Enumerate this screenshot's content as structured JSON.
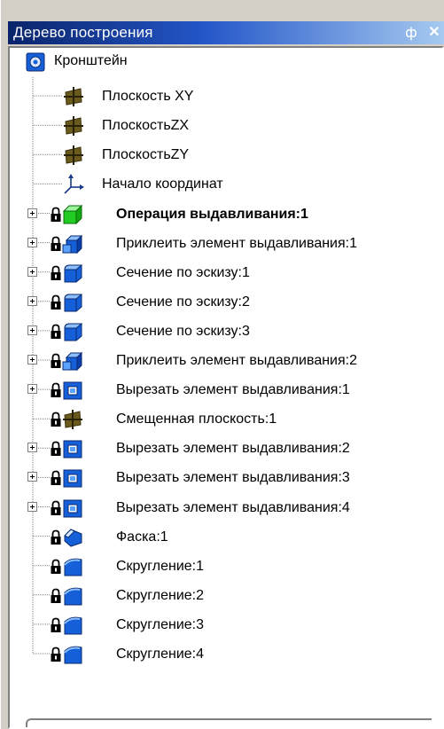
{
  "panel": {
    "title": "Дерево построения",
    "pin_label": "ф",
    "close_label": "✕"
  },
  "tree": {
    "root": {
      "label": "Кронштейн",
      "icon": "assembly-part-icon"
    },
    "items": [
      {
        "label": "Плоскость XY",
        "icon": "plane-icon",
        "expandable": false,
        "locked": false,
        "bold": false
      },
      {
        "label": "ПлоскостьZX",
        "icon": "plane-icon",
        "expandable": false,
        "locked": false,
        "bold": false
      },
      {
        "label": "ПлоскостьZY",
        "icon": "plane-icon",
        "expandable": false,
        "locked": false,
        "bold": false
      },
      {
        "label": "Начало координат",
        "icon": "origin-axes-icon",
        "expandable": false,
        "locked": false,
        "bold": false
      },
      {
        "label": "Операция выдавливания:1",
        "icon": "extrude-base-icon",
        "expandable": true,
        "locked": true,
        "bold": true
      },
      {
        "label": "Приклеить элемент выдавливания:1",
        "icon": "boss-extrude-icon",
        "expandable": true,
        "locked": true,
        "bold": false
      },
      {
        "label": "Сечение по эскизу:1",
        "icon": "sweep-icon",
        "expandable": true,
        "locked": true,
        "bold": false
      },
      {
        "label": "Сечение по эскизу:2",
        "icon": "sweep-icon",
        "expandable": true,
        "locked": true,
        "bold": false
      },
      {
        "label": "Сечение по эскизу:3",
        "icon": "sweep-icon",
        "expandable": true,
        "locked": true,
        "bold": false
      },
      {
        "label": "Приклеить элемент выдавливания:2",
        "icon": "boss-extrude-icon",
        "expandable": true,
        "locked": true,
        "bold": false
      },
      {
        "label": "Вырезать элемент выдавливания:1",
        "icon": "cut-extrude-icon",
        "expandable": true,
        "locked": true,
        "bold": false
      },
      {
        "label": "Смещенная плоскость:1",
        "icon": "plane-icon",
        "expandable": false,
        "locked": true,
        "bold": false
      },
      {
        "label": "Вырезать элемент выдавливания:2",
        "icon": "cut-extrude-icon",
        "expandable": true,
        "locked": true,
        "bold": false
      },
      {
        "label": "Вырезать элемент выдавливания:3",
        "icon": "cut-extrude-icon",
        "expandable": true,
        "locked": true,
        "bold": false
      },
      {
        "label": "Вырезать элемент выдавливания:4",
        "icon": "cut-extrude-icon",
        "expandable": true,
        "locked": true,
        "bold": false
      },
      {
        "label": "Фаска:1",
        "icon": "chamfer-icon",
        "expandable": false,
        "locked": true,
        "bold": false
      },
      {
        "label": "Скругление:1",
        "icon": "fillet-icon",
        "expandable": false,
        "locked": true,
        "bold": false
      },
      {
        "label": "Скругление:2",
        "icon": "fillet-icon",
        "expandable": false,
        "locked": true,
        "bold": false
      },
      {
        "label": "Скругление:3",
        "icon": "fillet-icon",
        "expandable": false,
        "locked": true,
        "bold": false
      },
      {
        "label": "Скругление:4",
        "icon": "fillet-icon",
        "expandable": false,
        "locked": true,
        "bold": false
      }
    ]
  },
  "colors": {
    "title_start": "#0a246a",
    "title_end": "#a6caf0",
    "feature_blue": "#1560d8",
    "feature_green": "#22cc22",
    "plane_brown": "#6b5a1e"
  }
}
